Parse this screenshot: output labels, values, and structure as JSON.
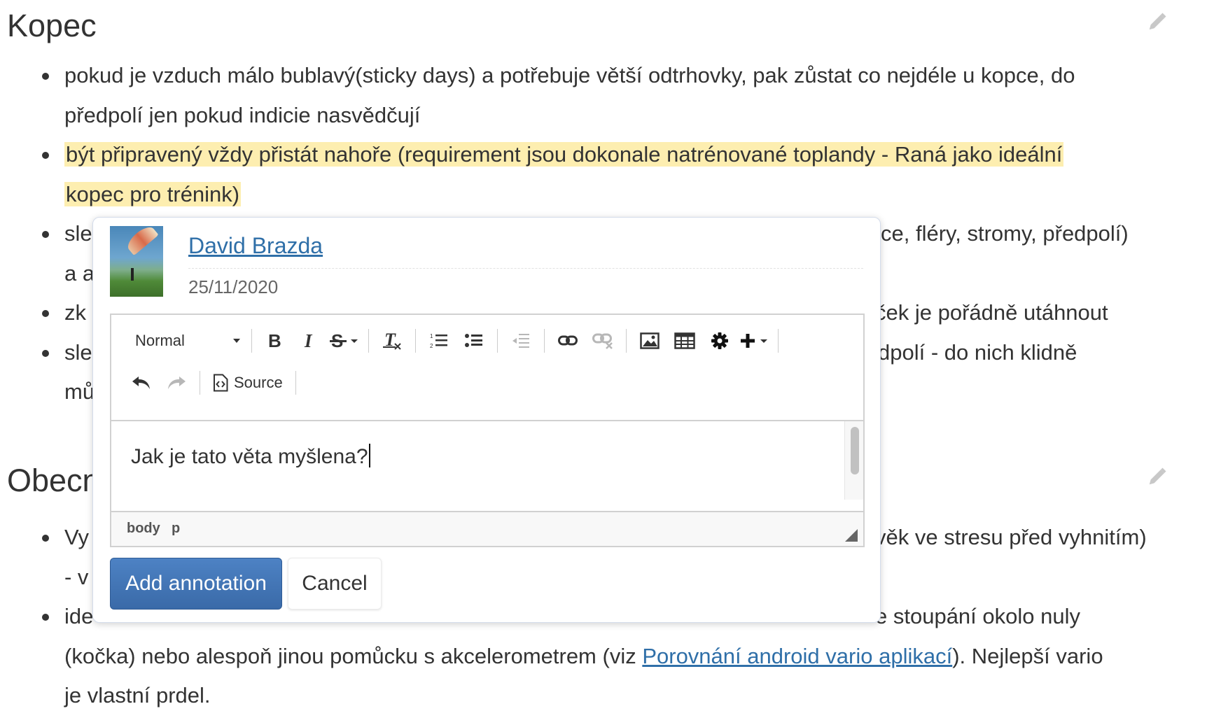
{
  "sections": {
    "kopec": {
      "title": "Kopec",
      "bullets": [
        "pokud je vzduch málo bublavý(sticky days) a potřebuje větší odtrhovky, pak zůstat co nejdéle u kopce, do",
        "předpolí jen pokud indicie nasvědčují",
        "být připravený vždy přistát nahoře (requirement jsou dokonale natrénované toplandy - Raná jako ideální",
        "kopec pro trénink)",
        "sle",
        "ce, fléry, stromy, předpolí)",
        "a a",
        "zk",
        "ček je pořádně utáhnout",
        "sle",
        "dpolí - do nich klidně",
        "mů"
      ]
    },
    "obecne": {
      "title": "Obecn",
      "bullets": [
        "Vy",
        "věk ve stresu před vyhnitím)",
        "- v",
        "ide",
        "e stoupání okolo nuly",
        "(kočka) nebo alespoň jinou pomůcku s akcelerometrem (viz ",
        "Porovnání android vario aplikací",
        "). Nejlepší vario",
        "je vlastní prdel."
      ]
    }
  },
  "popup": {
    "author": "David Brazda",
    "date": "25/11/2020",
    "toolbar": {
      "format": "Normal",
      "source": "Source",
      "icons": [
        "bold-icon",
        "italic-icon",
        "strikethrough-icon",
        "remove-format-icon",
        "numbered-list-icon",
        "bulleted-list-icon",
        "outdent-icon",
        "link-icon",
        "unlink-icon",
        "image-icon",
        "table-icon",
        "gear-icon",
        "plus-icon",
        "undo-icon",
        "redo-icon",
        "source-icon"
      ]
    },
    "content": "Jak je tato věta myšlena?",
    "path": {
      "body": "body",
      "p": "p"
    },
    "add_button": "Add annotation",
    "cancel_button": "Cancel"
  },
  "colors": {
    "highlight": "#fdeeb0",
    "link": "#2f6fa8",
    "primary": "#3a6aa8"
  }
}
